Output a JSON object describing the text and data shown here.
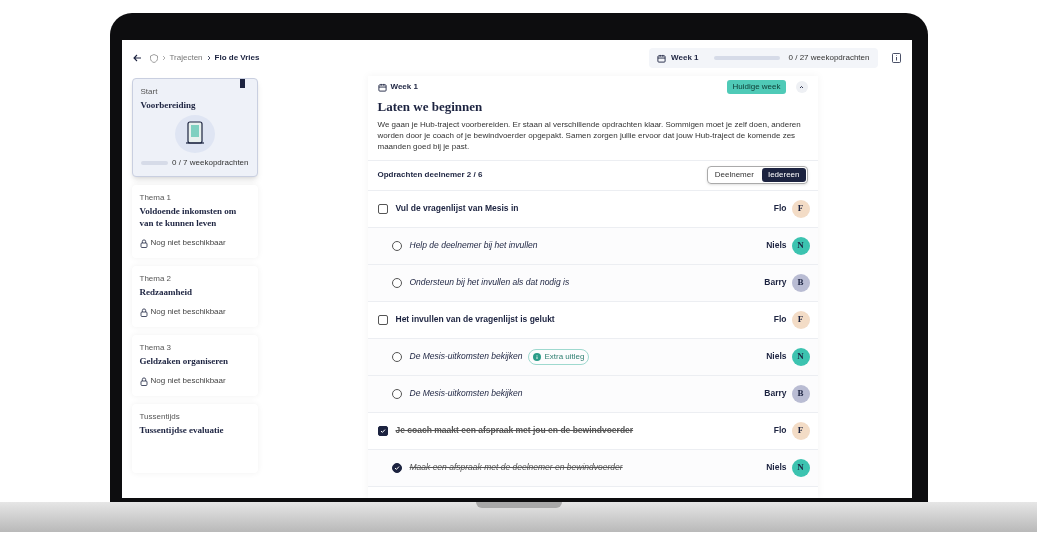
{
  "breadcrumb": {
    "items": [
      "Trajecten",
      "Flo de Vries"
    ]
  },
  "week_progress": {
    "label": "Week 1",
    "level": 0,
    "count": "0 / 27 weekopdrachten"
  },
  "sidebar": {
    "items": [
      {
        "kind": "progress",
        "selected": true,
        "label": "Start",
        "title": "Voorbereiding",
        "level": 0,
        "count": "0 / 7 weekopdrachten"
      },
      {
        "kind": "locked",
        "selected": false,
        "label": "Thema 1",
        "title": "Voldoende inkomsten om van te kunnen leven",
        "status": "Nog niet beschikbaar"
      },
      {
        "kind": "locked",
        "selected": false,
        "label": "Thema 2",
        "title": "Redzaamheid",
        "status": "Nog niet beschikbaar"
      },
      {
        "kind": "locked",
        "selected": false,
        "label": "Thema 3",
        "title": "Geldzaken organiseren",
        "status": "Nog niet beschikbaar"
      },
      {
        "kind": "locked",
        "selected": false,
        "label": "Tussentijds",
        "title": "Tussentijdse evaluatie"
      }
    ]
  },
  "week": {
    "label": "Week 1",
    "badge": "Huidige week",
    "expanded": true,
    "title": "Laten we beginnen",
    "description": "We gaan je Hub-traject voorbereiden. Er staan al verschillende opdrachten klaar. Sommigen moet je zelf doen, anderen worden door je coach of je bewindvoerder opgepakt. Samen zorgen jullie ervoor dat jouw Hub-traject de komende zes maanden goed bij je past.",
    "count": "Opdrachten deelnemer 2 / 6",
    "filters": [
      {
        "label": "Deelnemer",
        "selected": false
      },
      {
        "label": "Iedereen",
        "selected": true
      }
    ],
    "tasks": [
      {
        "kind": "task",
        "checked": false,
        "text": "Vul de vragenlijst van Mesis in",
        "person": "Flo",
        "initial": "F",
        "color": "#f3dcc6"
      },
      {
        "kind": "subtask",
        "checked": false,
        "text": "Help de deelnemer bij het invullen",
        "person": "Niels",
        "initial": "N",
        "color": "#3cc3b0"
      },
      {
        "kind": "subtask",
        "checked": false,
        "text": "Ondersteun bij het invullen als dat nodig is",
        "person": "Barry",
        "initial": "B",
        "color": "#b9bcd3"
      },
      {
        "kind": "task",
        "checked": false,
        "text": "Het invullen van de vragenlijst is gelukt",
        "person": "Flo",
        "initial": "F",
        "color": "#f3dcc6"
      },
      {
        "kind": "subtask",
        "checked": false,
        "text": "De Mesis-uitkomsten bekijken",
        "badge": "Extra uitleg",
        "person": "Niels",
        "initial": "N",
        "color": "#3cc3b0"
      },
      {
        "kind": "subtask",
        "checked": false,
        "text": "De Mesis-uitkomsten bekijken",
        "person": "Barry",
        "initial": "B",
        "color": "#b9bcd3"
      },
      {
        "kind": "task",
        "checked": true,
        "text": "Je coach maakt een afspraak met jou en de bewindvoerder",
        "person": "Flo",
        "initial": "F",
        "color": "#f3dcc6"
      },
      {
        "kind": "subtask",
        "checked": true,
        "text": "Maak een afspraak met de deelnemer en bewindvoerder",
        "person": "Niels",
        "initial": "N",
        "color": "#3cc3b0"
      }
    ]
  }
}
